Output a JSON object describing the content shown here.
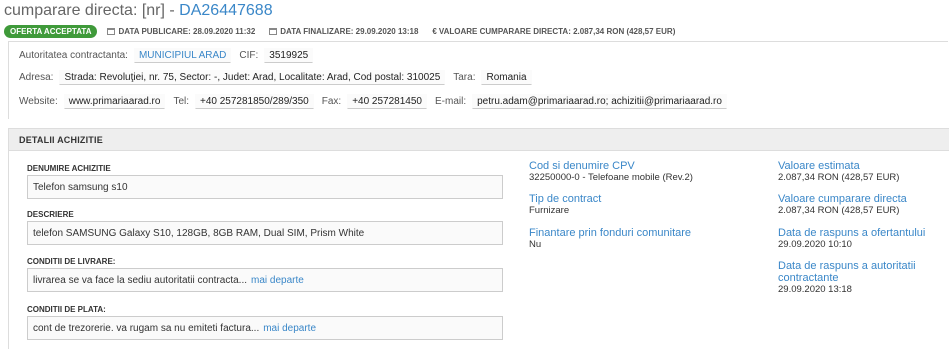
{
  "header": {
    "title_prefix": "cumparare directa: [nr] - ",
    "code": "DA26447688",
    "status_badge": "OFERTA ACCEPTATA",
    "data_publicare": "DATA PUBLICARE: 28.09.2020 11:32",
    "data_finalizare": "DATA FINALIZARE: 29.09.2020 13:18",
    "valoare_symbol": "€",
    "valoare": "VALOARE CUMPARARE DIRECTA: 2.087,34 RON (428,57 EUR)"
  },
  "authority": {
    "autoritate_label": "Autoritatea contractanta:",
    "autoritate_value": "MUNICIPIUL ARAD",
    "cif_label": "CIF:",
    "cif_value": "3519925",
    "adresa_label": "Adresa:",
    "adresa_value": "Strada: Revoluţiei, nr. 75, Sector: -, Judet: Arad, Localitate: Arad, Cod postal: 310025",
    "tara_label": "Tara:",
    "tara_value": "Romania",
    "website_label": "Website:",
    "website_value": "www.primariaarad.ro",
    "tel_label": "Tel:",
    "tel_value": "+40 257281850/289/350",
    "fax_label": "Fax:",
    "fax_value": "+40 257281450",
    "email_label": "E-mail:",
    "email_value": "petru.adam@primariaarad.ro; achizitii@primariaarad.ro"
  },
  "details": {
    "section_title": "DETALII ACHIZITIE",
    "denumire_label": "DENUMIRE ACHIZITIE",
    "denumire_value": "Telefon samsung s10",
    "descriere_label": "DESCRIERE",
    "descriere_value": "telefon SAMSUNG Galaxy S10, 128GB, 8GB RAM, Dual SIM, Prism White",
    "livrare_label": "CONDITII DE LIVRARE:",
    "livrare_value": "livrarea se va face la sediu autoritatii contracta...",
    "plata_label": "CONDITII DE PLATA:",
    "plata_value": "cont de trezorerie. va rugam sa nu emiteti factura...",
    "more_label": "mai departe",
    "cpv_label": "Cod si denumire CPV",
    "cpv_value": "32250000-0 - Telefoane mobile (Rev.2)",
    "tip_label": "Tip de contract",
    "tip_value": "Furnizare",
    "finantare_label": "Finantare prin fonduri comunitare",
    "finantare_value": "Nu",
    "estimata_label": "Valoare estimata",
    "estimata_value": "2.087,34  RON (428,57  EUR)",
    "cumparare_label": "Valoare cumparare directa",
    "cumparare_value": "2.087,34  RON (428,57  EUR)",
    "raspuns_ofertant_label": "Data de raspuns a ofertantului",
    "raspuns_ofertant_value": "29.09.2020 10:10",
    "raspuns_autoritate_label": "Data de raspuns a autoritatii contractante",
    "raspuns_autoritate_value": "29.09.2020 13:18"
  }
}
